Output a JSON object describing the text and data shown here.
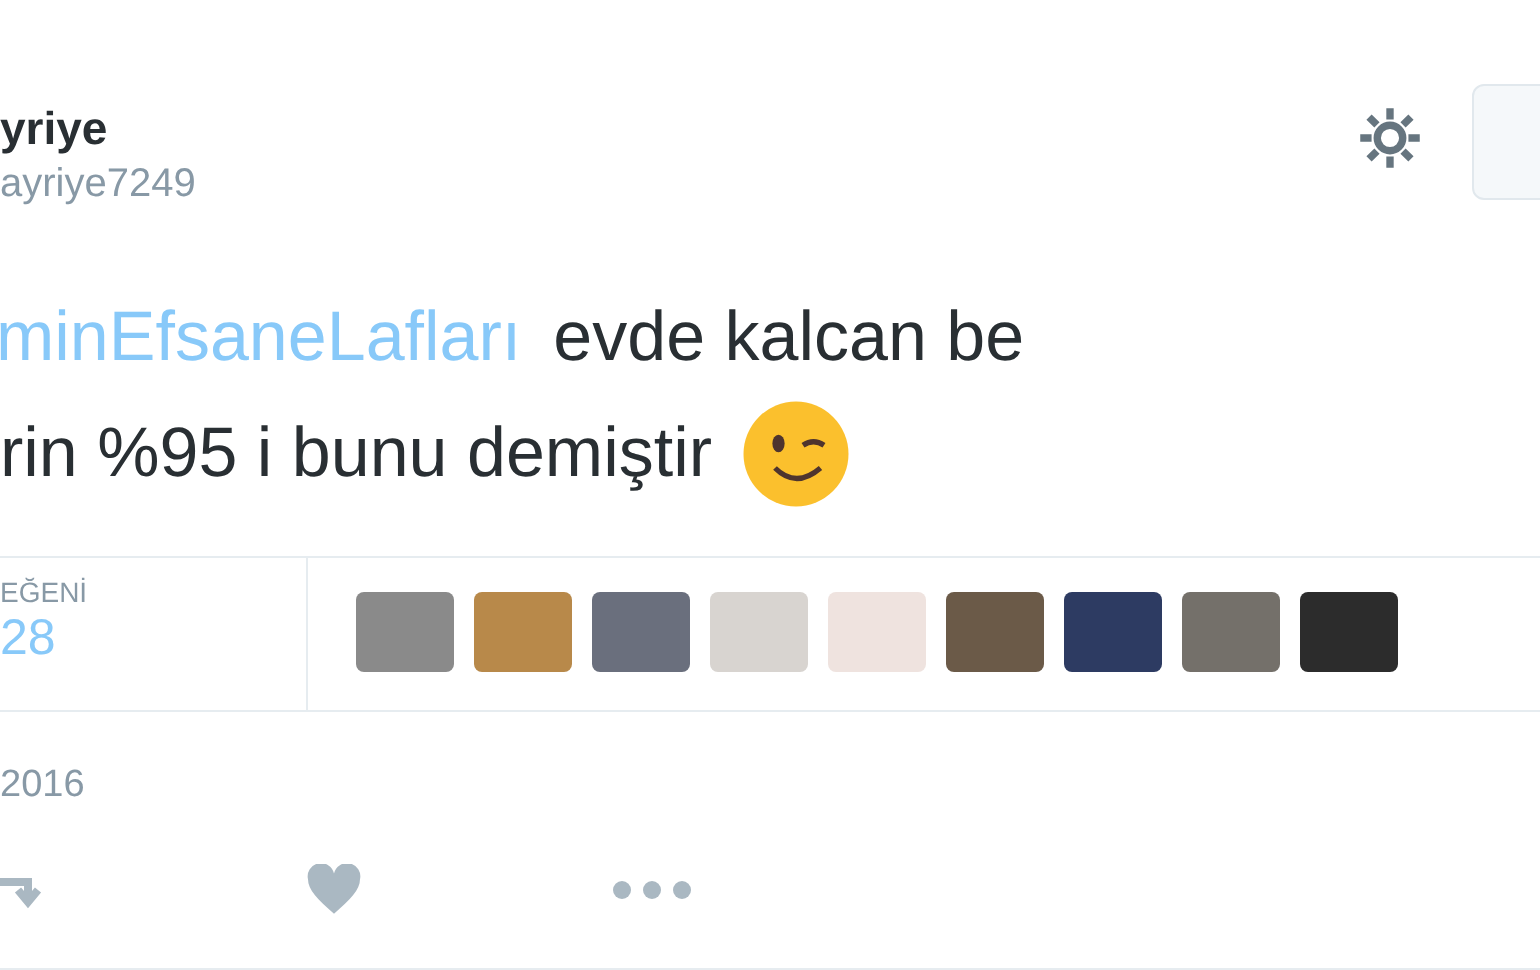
{
  "author": {
    "name": "yriye",
    "handle": "ayriye7249"
  },
  "tweet": {
    "hashtag": "minEfsaneLafları",
    "line_1_rest": "evde kalcan be",
    "line_2": "rin %95 i bunu demiştir"
  },
  "stats": {
    "label": "EĞENİ",
    "count": "28"
  },
  "date": "2016"
}
